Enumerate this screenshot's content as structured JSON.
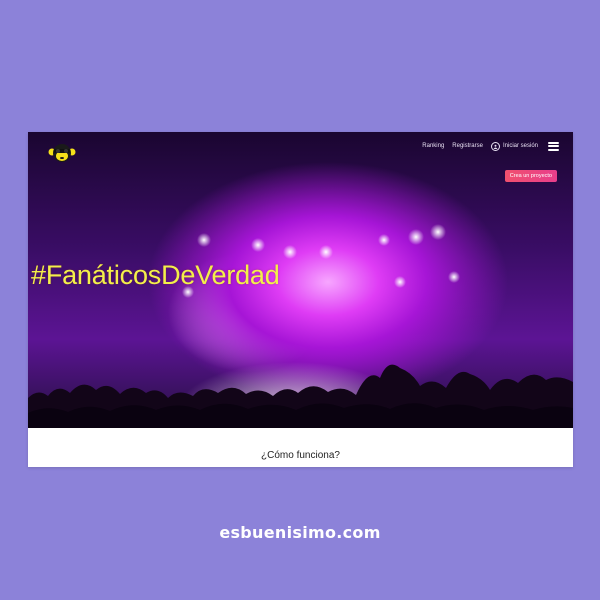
{
  "nav": {
    "ranking": "Ranking",
    "register": "Registrarse",
    "login": "Iniciar sesión"
  },
  "hero": {
    "hashtag": "#FanáticosDeVerdad",
    "cta_label": "Crea un proyecto"
  },
  "how_it_works": {
    "title": "¿Cómo funciona?"
  },
  "footer": {
    "caption": "esbuenisimo.com"
  },
  "colors": {
    "page_bg": "#8c82d9",
    "hashtag": "#f3ef4a",
    "cta": "#f0506e",
    "logo_yellow": "#f5e11a"
  },
  "icons": [
    "monkey-logo-icon",
    "user-circle-icon",
    "hamburger-menu-icon"
  ]
}
